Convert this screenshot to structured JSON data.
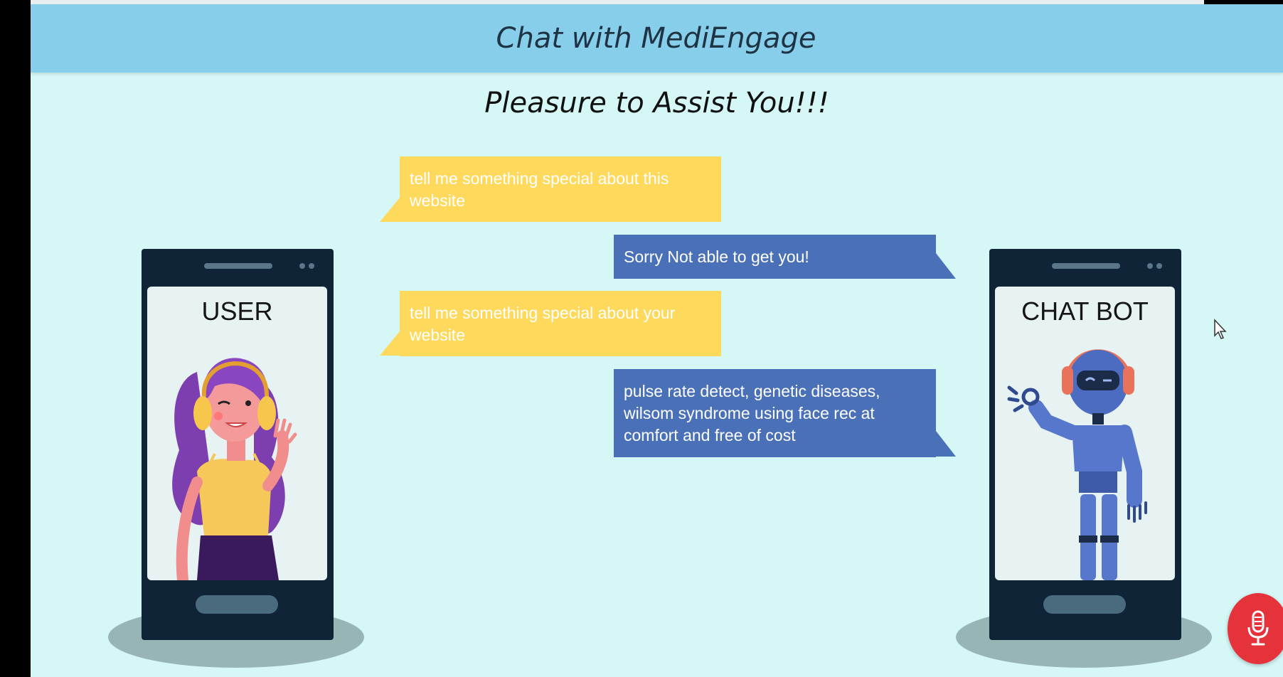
{
  "header": {
    "title": "Chat with MediEngage"
  },
  "subtitle": "Pleasure to Assist You!!!",
  "user_phone": {
    "label": "USER"
  },
  "bot_phone": {
    "label": "CHAT BOT"
  },
  "messages": [
    {
      "sender": "user",
      "text": "tell me something special about this website"
    },
    {
      "sender": "bot",
      "text": "Sorry Not able to get you!"
    },
    {
      "sender": "user",
      "text": "tell me something special about your website"
    },
    {
      "sender": "bot",
      "text": "pulse rate detect, genetic diseases, wilsom syndrome using face rec at comfort and free of cost"
    }
  ],
  "colors": {
    "header": "#87ceeb",
    "background": "#d5f8f7",
    "user_bubble": "#fed95b",
    "bot_bubble": "#4a70b8",
    "mic_button": "#e6323a"
  },
  "icons": {
    "mic_button": "microphone-icon",
    "cursor": "mouse-pointer-icon"
  }
}
